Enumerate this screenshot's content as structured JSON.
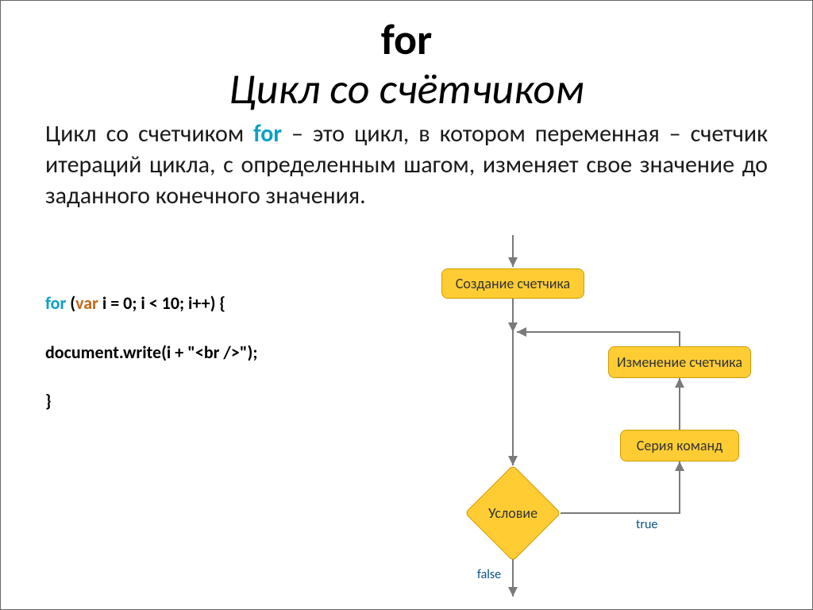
{
  "title": {
    "line1": "for",
    "line2": "Цикл со счётчиком"
  },
  "desc": {
    "pre": "Цикл со счетчиком ",
    "kw": "for",
    "post": " – это цикл, в котором переменная – счетчик итераций цикла, с определенным шагом, изменяет свое значение до заданного конечного значения."
  },
  "code": {
    "l1_for": "for",
    "l1_open": " (",
    "l1_var": "var",
    "l1_rest": " i = 0; i < 10; i++) {",
    "l2": "document.write(i + \"<br />\");",
    "l3": "}"
  },
  "flow": {
    "create": "Создание счетчика",
    "change": "Изменение счетчика",
    "series": "Серия команд",
    "cond": "Условие",
    "true": "true",
    "false": "false"
  }
}
